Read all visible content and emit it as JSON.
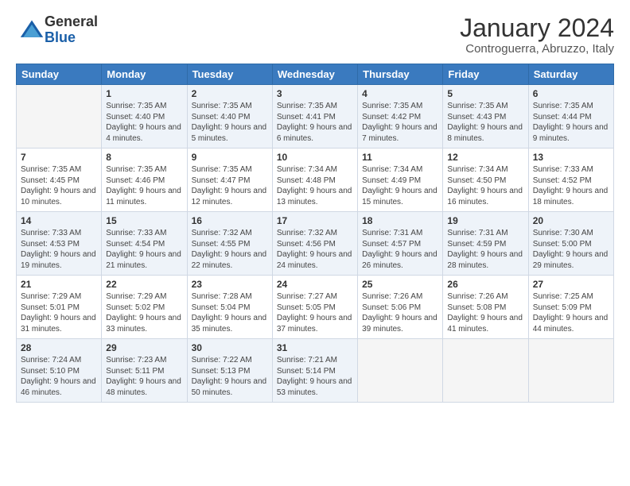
{
  "logo": {
    "general": "General",
    "blue": "Blue"
  },
  "title": "January 2024",
  "location": "Controguerra, Abruzzo, Italy",
  "days_header": [
    "Sunday",
    "Monday",
    "Tuesday",
    "Wednesday",
    "Thursday",
    "Friday",
    "Saturday"
  ],
  "weeks": [
    [
      {
        "num": "",
        "sunrise": "",
        "sunset": "",
        "daylight": ""
      },
      {
        "num": "1",
        "sunrise": "Sunrise: 7:35 AM",
        "sunset": "Sunset: 4:40 PM",
        "daylight": "Daylight: 9 hours and 4 minutes."
      },
      {
        "num": "2",
        "sunrise": "Sunrise: 7:35 AM",
        "sunset": "Sunset: 4:40 PM",
        "daylight": "Daylight: 9 hours and 5 minutes."
      },
      {
        "num": "3",
        "sunrise": "Sunrise: 7:35 AM",
        "sunset": "Sunset: 4:41 PM",
        "daylight": "Daylight: 9 hours and 6 minutes."
      },
      {
        "num": "4",
        "sunrise": "Sunrise: 7:35 AM",
        "sunset": "Sunset: 4:42 PM",
        "daylight": "Daylight: 9 hours and 7 minutes."
      },
      {
        "num": "5",
        "sunrise": "Sunrise: 7:35 AM",
        "sunset": "Sunset: 4:43 PM",
        "daylight": "Daylight: 9 hours and 8 minutes."
      },
      {
        "num": "6",
        "sunrise": "Sunrise: 7:35 AM",
        "sunset": "Sunset: 4:44 PM",
        "daylight": "Daylight: 9 hours and 9 minutes."
      }
    ],
    [
      {
        "num": "7",
        "sunrise": "Sunrise: 7:35 AM",
        "sunset": "Sunset: 4:45 PM",
        "daylight": "Daylight: 9 hours and 10 minutes."
      },
      {
        "num": "8",
        "sunrise": "Sunrise: 7:35 AM",
        "sunset": "Sunset: 4:46 PM",
        "daylight": "Daylight: 9 hours and 11 minutes."
      },
      {
        "num": "9",
        "sunrise": "Sunrise: 7:35 AM",
        "sunset": "Sunset: 4:47 PM",
        "daylight": "Daylight: 9 hours and 12 minutes."
      },
      {
        "num": "10",
        "sunrise": "Sunrise: 7:34 AM",
        "sunset": "Sunset: 4:48 PM",
        "daylight": "Daylight: 9 hours and 13 minutes."
      },
      {
        "num": "11",
        "sunrise": "Sunrise: 7:34 AM",
        "sunset": "Sunset: 4:49 PM",
        "daylight": "Daylight: 9 hours and 15 minutes."
      },
      {
        "num": "12",
        "sunrise": "Sunrise: 7:34 AM",
        "sunset": "Sunset: 4:50 PM",
        "daylight": "Daylight: 9 hours and 16 minutes."
      },
      {
        "num": "13",
        "sunrise": "Sunrise: 7:33 AM",
        "sunset": "Sunset: 4:52 PM",
        "daylight": "Daylight: 9 hours and 18 minutes."
      }
    ],
    [
      {
        "num": "14",
        "sunrise": "Sunrise: 7:33 AM",
        "sunset": "Sunset: 4:53 PM",
        "daylight": "Daylight: 9 hours and 19 minutes."
      },
      {
        "num": "15",
        "sunrise": "Sunrise: 7:33 AM",
        "sunset": "Sunset: 4:54 PM",
        "daylight": "Daylight: 9 hours and 21 minutes."
      },
      {
        "num": "16",
        "sunrise": "Sunrise: 7:32 AM",
        "sunset": "Sunset: 4:55 PM",
        "daylight": "Daylight: 9 hours and 22 minutes."
      },
      {
        "num": "17",
        "sunrise": "Sunrise: 7:32 AM",
        "sunset": "Sunset: 4:56 PM",
        "daylight": "Daylight: 9 hours and 24 minutes."
      },
      {
        "num": "18",
        "sunrise": "Sunrise: 7:31 AM",
        "sunset": "Sunset: 4:57 PM",
        "daylight": "Daylight: 9 hours and 26 minutes."
      },
      {
        "num": "19",
        "sunrise": "Sunrise: 7:31 AM",
        "sunset": "Sunset: 4:59 PM",
        "daylight": "Daylight: 9 hours and 28 minutes."
      },
      {
        "num": "20",
        "sunrise": "Sunrise: 7:30 AM",
        "sunset": "Sunset: 5:00 PM",
        "daylight": "Daylight: 9 hours and 29 minutes."
      }
    ],
    [
      {
        "num": "21",
        "sunrise": "Sunrise: 7:29 AM",
        "sunset": "Sunset: 5:01 PM",
        "daylight": "Daylight: 9 hours and 31 minutes."
      },
      {
        "num": "22",
        "sunrise": "Sunrise: 7:29 AM",
        "sunset": "Sunset: 5:02 PM",
        "daylight": "Daylight: 9 hours and 33 minutes."
      },
      {
        "num": "23",
        "sunrise": "Sunrise: 7:28 AM",
        "sunset": "Sunset: 5:04 PM",
        "daylight": "Daylight: 9 hours and 35 minutes."
      },
      {
        "num": "24",
        "sunrise": "Sunrise: 7:27 AM",
        "sunset": "Sunset: 5:05 PM",
        "daylight": "Daylight: 9 hours and 37 minutes."
      },
      {
        "num": "25",
        "sunrise": "Sunrise: 7:26 AM",
        "sunset": "Sunset: 5:06 PM",
        "daylight": "Daylight: 9 hours and 39 minutes."
      },
      {
        "num": "26",
        "sunrise": "Sunrise: 7:26 AM",
        "sunset": "Sunset: 5:08 PM",
        "daylight": "Daylight: 9 hours and 41 minutes."
      },
      {
        "num": "27",
        "sunrise": "Sunrise: 7:25 AM",
        "sunset": "Sunset: 5:09 PM",
        "daylight": "Daylight: 9 hours and 44 minutes."
      }
    ],
    [
      {
        "num": "28",
        "sunrise": "Sunrise: 7:24 AM",
        "sunset": "Sunset: 5:10 PM",
        "daylight": "Daylight: 9 hours and 46 minutes."
      },
      {
        "num": "29",
        "sunrise": "Sunrise: 7:23 AM",
        "sunset": "Sunset: 5:11 PM",
        "daylight": "Daylight: 9 hours and 48 minutes."
      },
      {
        "num": "30",
        "sunrise": "Sunrise: 7:22 AM",
        "sunset": "Sunset: 5:13 PM",
        "daylight": "Daylight: 9 hours and 50 minutes."
      },
      {
        "num": "31",
        "sunrise": "Sunrise: 7:21 AM",
        "sunset": "Sunset: 5:14 PM",
        "daylight": "Daylight: 9 hours and 53 minutes."
      },
      {
        "num": "",
        "sunrise": "",
        "sunset": "",
        "daylight": ""
      },
      {
        "num": "",
        "sunrise": "",
        "sunset": "",
        "daylight": ""
      },
      {
        "num": "",
        "sunrise": "",
        "sunset": "",
        "daylight": ""
      }
    ]
  ]
}
